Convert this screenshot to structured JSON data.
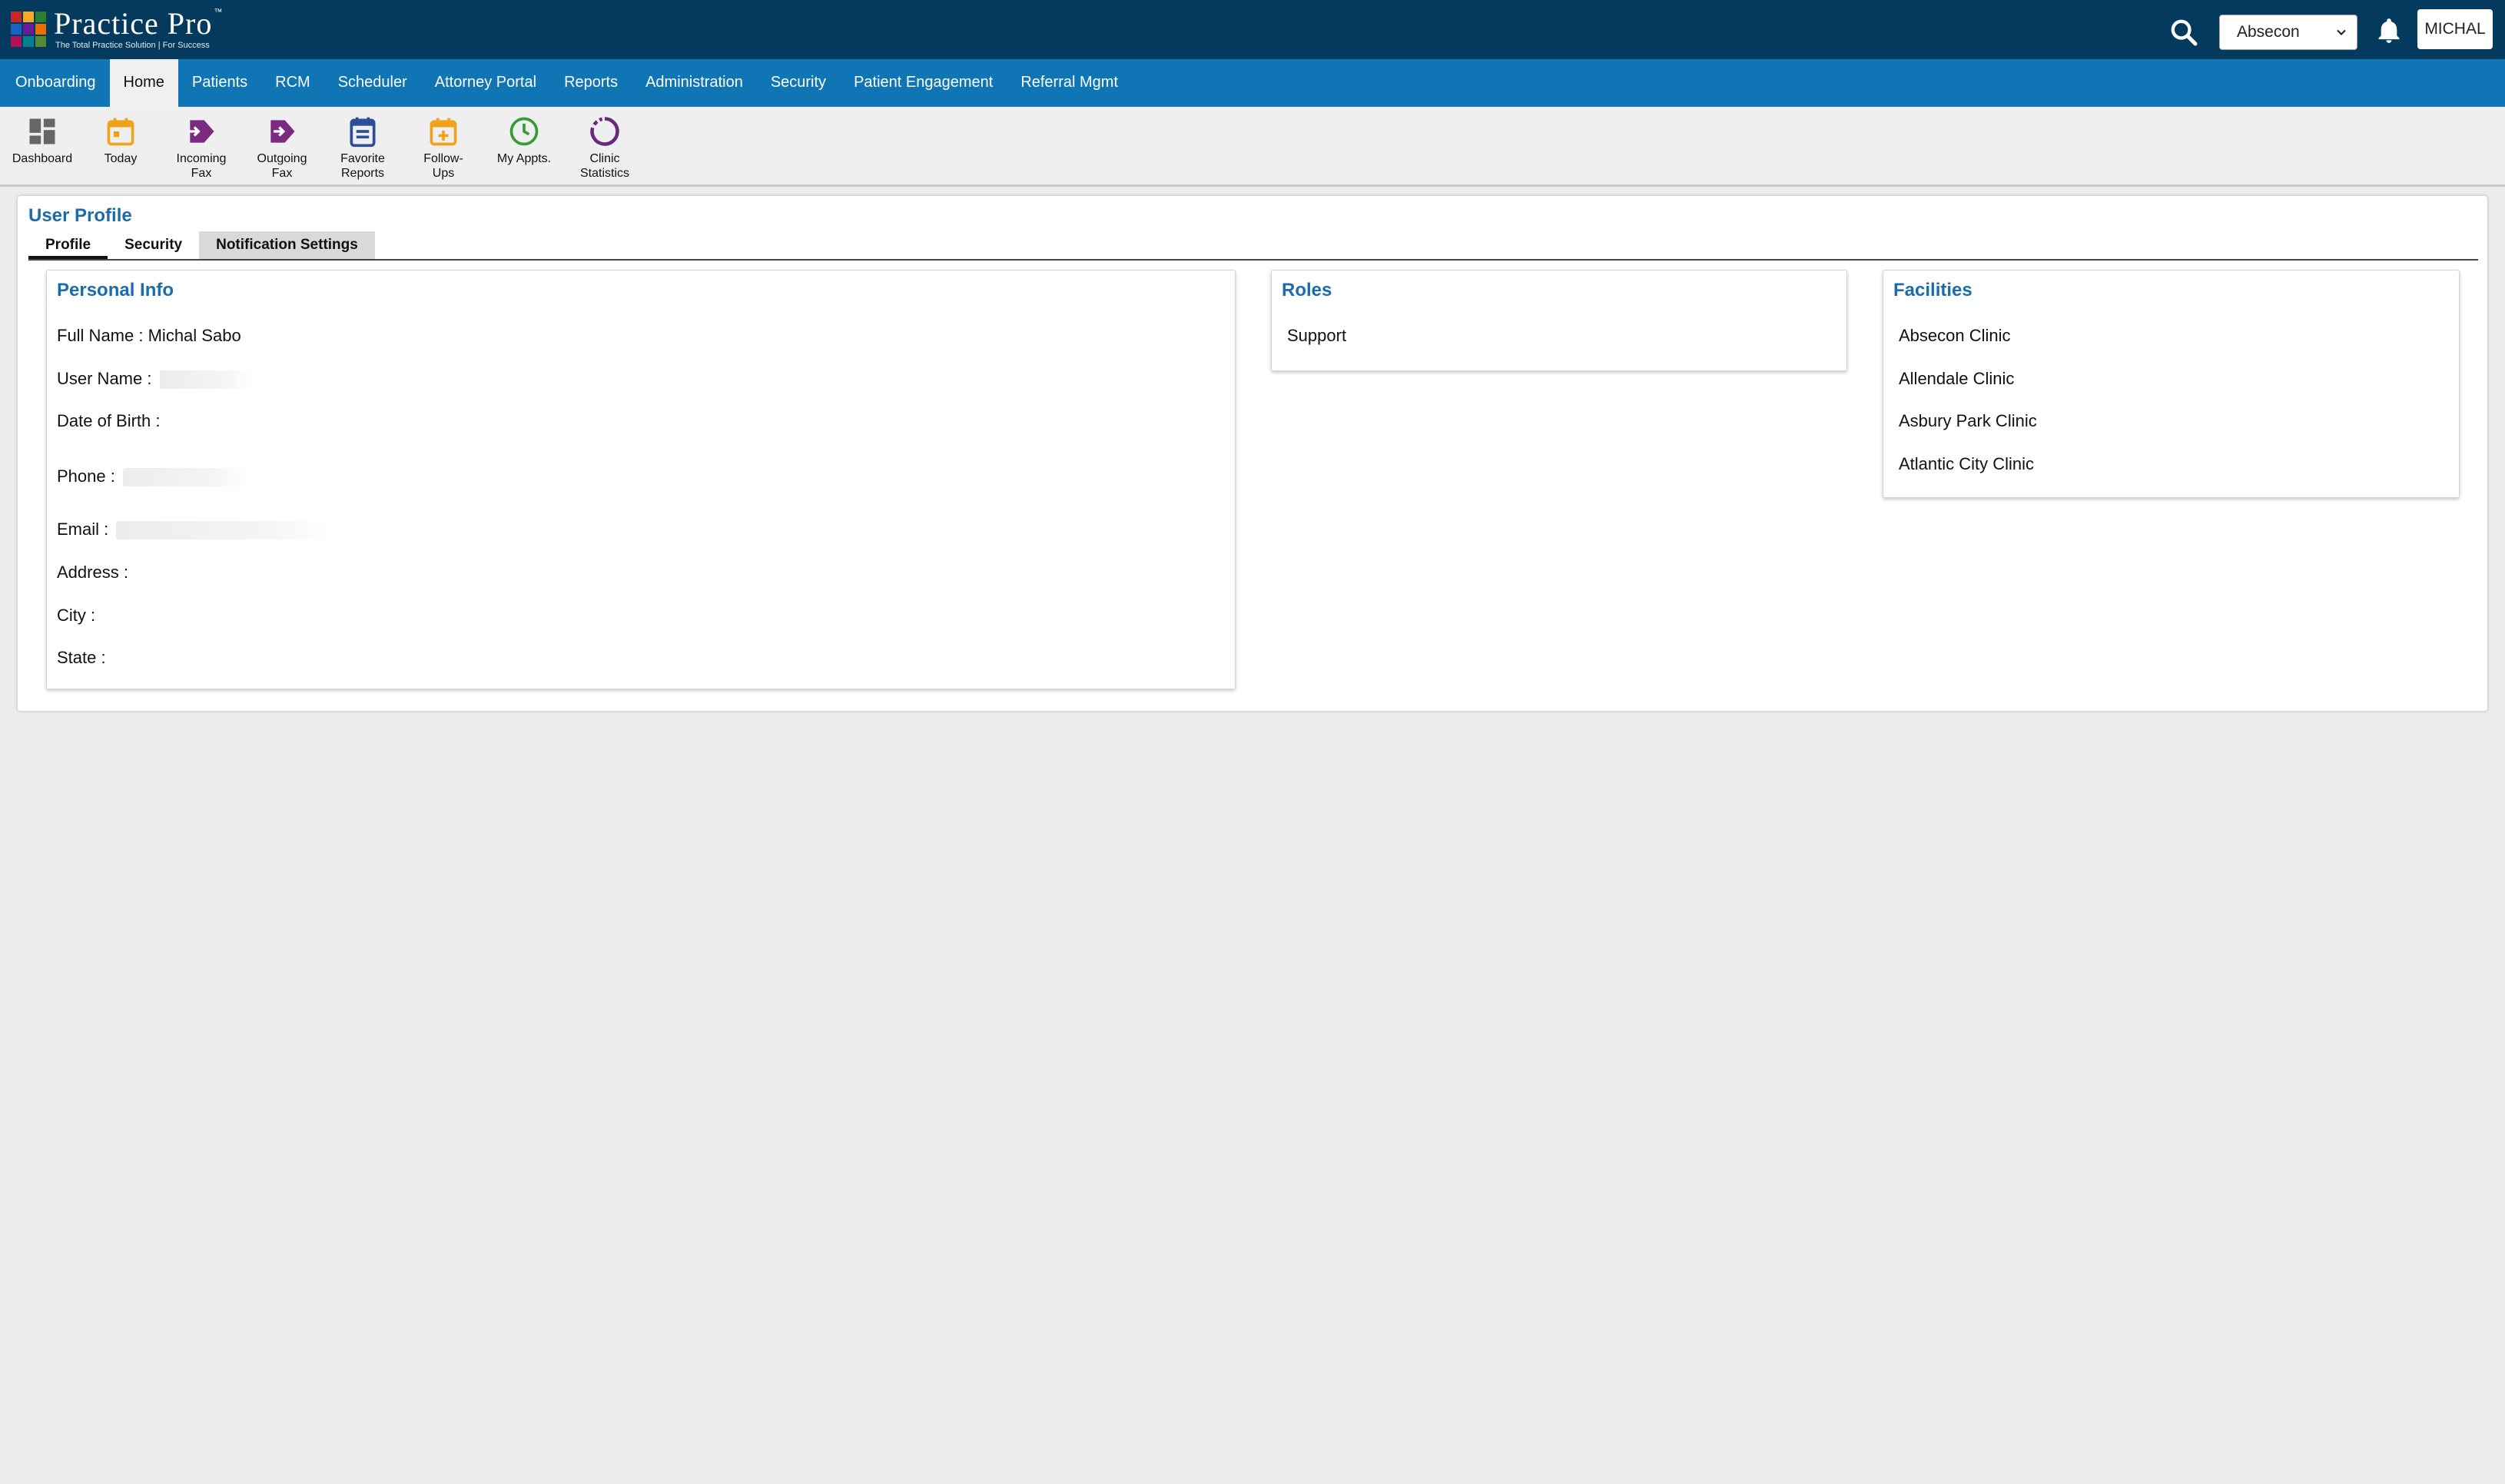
{
  "header": {
    "logo_title": "Practice Pro",
    "logo_tagline": "The Total Practice Solution | For Success",
    "logo_colors": [
      "#c62828",
      "#f9a825",
      "#2e7d32",
      "#1565c0",
      "#6a1b9a",
      "#ef6c00",
      "#ad1457",
      "#00838f",
      "#558b2f"
    ],
    "facility_selected": "Absecon",
    "user_button": "MICHAL",
    "icons": [
      "search-icon",
      "chevron-down-icon",
      "bell-icon"
    ]
  },
  "nav": {
    "items": [
      "Onboarding",
      "Home",
      "Patients",
      "RCM",
      "Scheduler",
      "Attorney Portal",
      "Reports",
      "Administration",
      "Security",
      "Patient Engagement",
      "Referral Mgmt"
    ],
    "active": "Home"
  },
  "toolbar": {
    "items": [
      {
        "label": "Dashboard",
        "icon": "dashboard-icon",
        "color": "#666666"
      },
      {
        "label": "Today",
        "icon": "calendar-today-icon",
        "color": "#f0a21a"
      },
      {
        "label": "Incoming\nFax",
        "icon": "incoming-fax-icon",
        "color": "#7b2a82"
      },
      {
        "label": "Outgoing\nFax",
        "icon": "outgoing-fax-icon",
        "color": "#7b2a82"
      },
      {
        "label": "Favorite\nReports",
        "icon": "favorite-reports-icon",
        "color": "#2b4d9a"
      },
      {
        "label": "Follow-\nUps",
        "icon": "follow-ups-icon",
        "color": "#f0a21a"
      },
      {
        "label": "My Appts.",
        "icon": "clock-icon",
        "color": "#3a9a3a"
      },
      {
        "label": "Clinic\nStatistics",
        "icon": "statistics-icon",
        "color": "#6a2a7a"
      }
    ]
  },
  "profile": {
    "title": "User Profile",
    "tabs": [
      "Profile",
      "Security",
      "Notification Settings"
    ],
    "active_tab": "Profile",
    "personal_info": {
      "title": "Personal Info",
      "full_name_label": "Full Name :",
      "full_name": "Michal Sabo",
      "user_name_label": "User Name :",
      "dob_label": "Date of Birth :",
      "phone_label": "Phone :",
      "email_label": "Email :",
      "address_label": "Address :",
      "city_label": "City :",
      "state_label": "State :"
    },
    "roles": {
      "title": "Roles",
      "items": [
        "Support"
      ]
    },
    "facilities": {
      "title": "Facilities",
      "items": [
        "Absecon Clinic",
        "Allendale Clinic",
        "Asbury Park Clinic",
        "Atlantic City Clinic"
      ]
    }
  },
  "colors": {
    "topbar": "#043a5e",
    "nav": "#0f75b5",
    "accent_title": "#1b6ca8"
  }
}
